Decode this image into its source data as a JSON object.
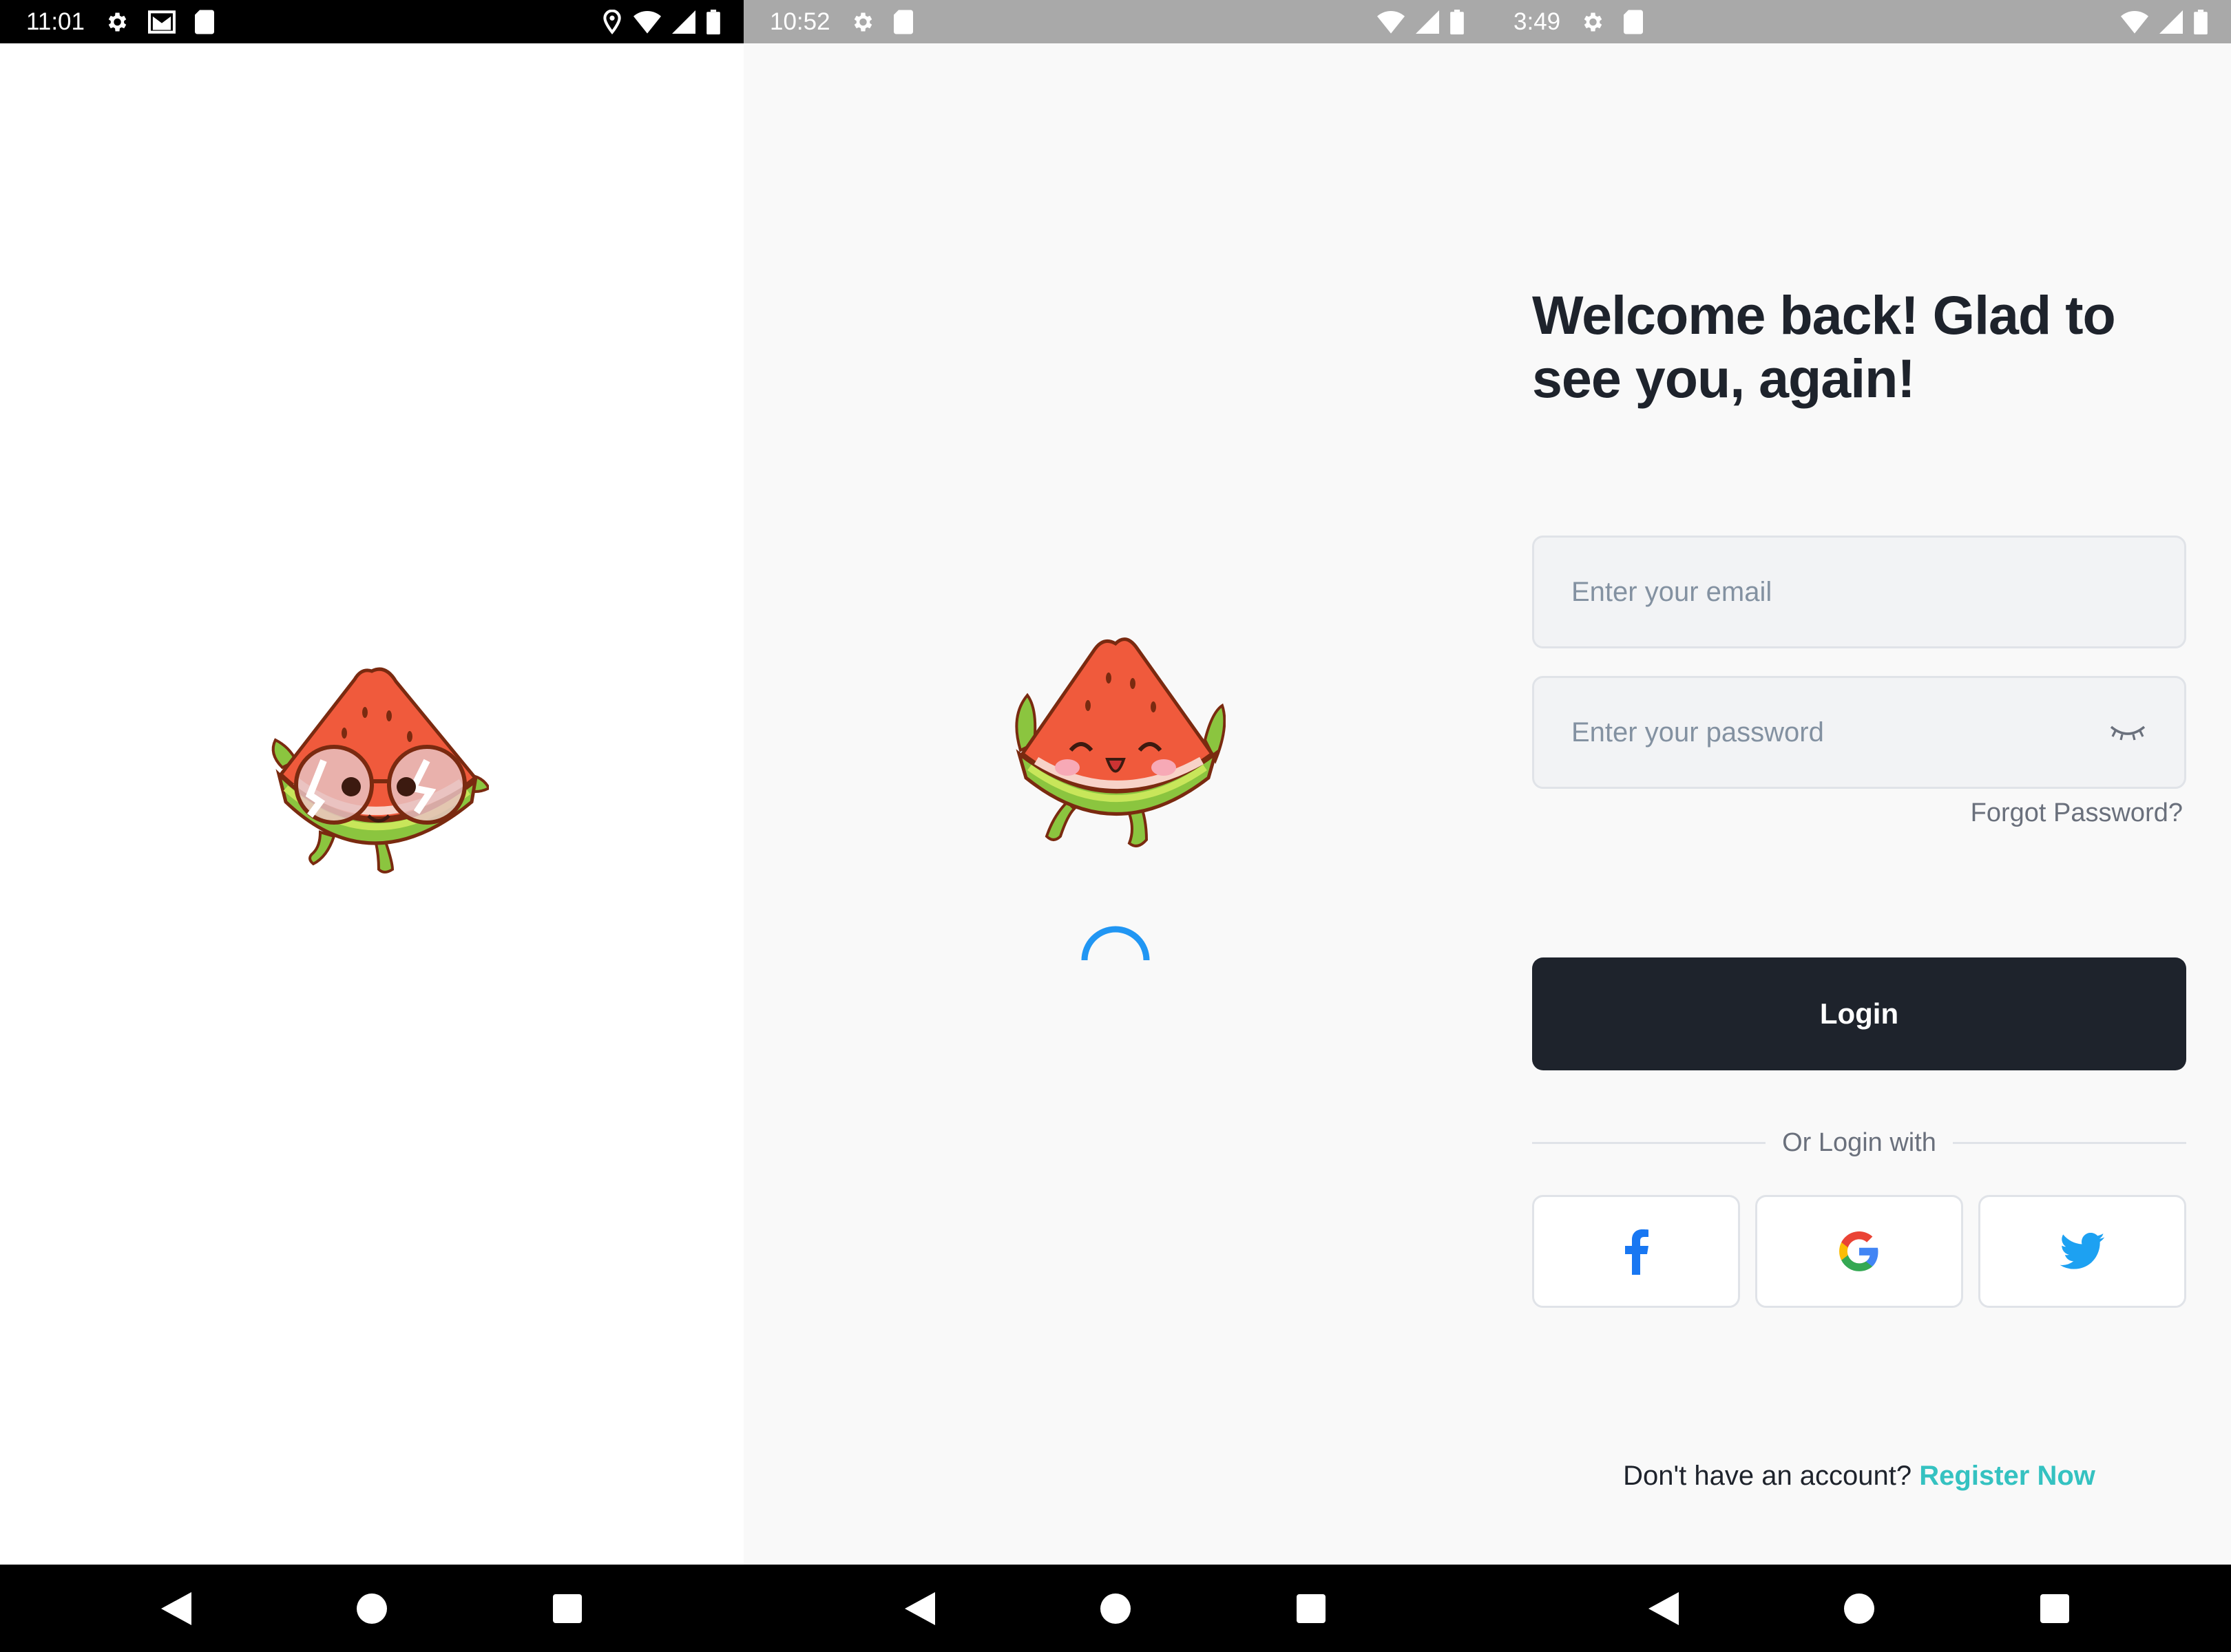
{
  "screens": [
    {
      "name": "splash",
      "status_time": "11:01",
      "background": "#ffffff"
    },
    {
      "name": "loading",
      "status_time": "10:52",
      "background": "#f9f9f9"
    },
    {
      "name": "login",
      "status_time": "3:49",
      "background": "#f9f9f9"
    }
  ],
  "login": {
    "title_line1": "Welcome back! Glad to",
    "title_line2": "see you, again!",
    "email_placeholder": "Enter your email",
    "password_placeholder": "Enter your password",
    "forgot_password": "Forgot Password?",
    "login_button": "Login",
    "or_login_with": "Or Login with",
    "social": [
      "facebook-icon",
      "google-icon",
      "twitter-icon"
    ],
    "no_account": "Don't have an account?",
    "register_now": "Register Now"
  },
  "colors": {
    "primary_dark": "#1e232c",
    "accent": "#35c2c1",
    "spinner": "#2196f3",
    "facebook": "#1877f2",
    "twitter": "#1da1f2"
  }
}
